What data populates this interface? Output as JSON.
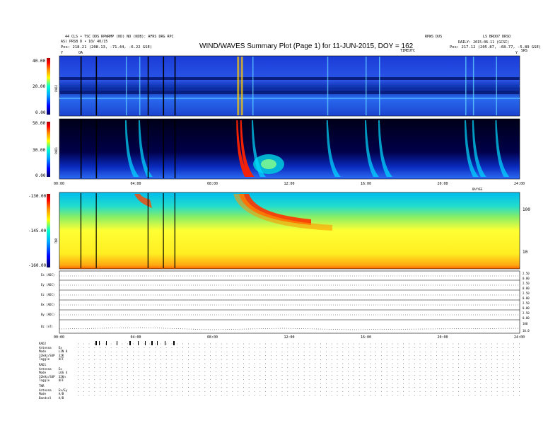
{
  "header": {
    "left_line1": "44 CLS • TSC DDS RPWRMP (KD) NO (KDB): AFRS DRG RPC",
    "left_line2": "AS) PRSB D • 10/ 40/15",
    "left_pos": "Pos: 218.21 (208.13, -71.44, -6.22 GSE)",
    "right_top_a": "RPWS DUS",
    "right_top_b": "LS BROO7 DRSO",
    "right_line2": "DAILY: 2015-06-11 (GCSI)",
    "right_pos": "Pos: 217.12 (205.87, -68.77, -5.89 GSE)",
    "time_label": "TIMEUTC",
    "marker_left_a": "Y",
    "marker_left_b": "OA",
    "marker_right_a": "Y",
    "marker_right_b": "SRS"
  },
  "title": "WIND/WAVES Summary Plot (Page 1) for 11-JUN-2015, DOY = 162",
  "panels": {
    "rad2": {
      "label": "RAD2",
      "ticks": [
        "40.00",
        "20.00",
        "0.00"
      ]
    },
    "rad1": {
      "label": "RAD1",
      "ticks": [
        "50.00",
        "30.00",
        "0.00"
      ]
    },
    "tnr": {
      "label": "TNR",
      "ticks": [
        "-130.00",
        "-145.00",
        "-160.00"
      ],
      "right_ticks": [
        "100",
        "10"
      ],
      "right_caption": "BAYYEE"
    },
    "scalars": [
      {
        "label": "Ex (ADC)",
        "ticks": [
          "2.50",
          "0.00"
        ]
      },
      {
        "label": "Ey (ADC)",
        "ticks": [
          "2.50",
          "0.00"
        ]
      },
      {
        "label": "Ez (ADC)",
        "ticks": [
          "2.50",
          "0.00"
        ]
      },
      {
        "label": "Bx (ADC)",
        "ticks": [
          "2.50",
          "0.00"
        ]
      },
      {
        "label": "By (ADC)",
        "ticks": [
          "2.50",
          "0.00"
        ]
      },
      {
        "label": "Bz (nT)",
        "ticks": [
          "100",
          "10.0"
        ]
      }
    ]
  },
  "time_ticks": [
    "00:00",
    "04:00",
    "08:00",
    "12:00",
    "16:00",
    "20:00",
    "24:00"
  ],
  "housekeeping": {
    "rad2": [
      {
        "name": "RAD2",
        "value": ""
      },
      {
        "name": "Antenna",
        "value": "Ex"
      },
      {
        "name": "Mode",
        "value": "LIN 8"
      },
      {
        "name": "32kHz/SUP",
        "value": "32K"
      },
      {
        "name": "Toggle",
        "value": "OFF"
      }
    ],
    "rad1": [
      {
        "name": "RAD1",
        "value": ""
      },
      {
        "name": "Antenna",
        "value": "Ex"
      },
      {
        "name": "Mode",
        "value": "LOG 4"
      },
      {
        "name": "32kHz/SUP",
        "value": "32Kn"
      },
      {
        "name": "Toggle",
        "value": "OFF"
      }
    ],
    "tnr": [
      {
        "name": "TNR",
        "value": ""
      },
      {
        "name": "Antenna",
        "value": "Ex/Ey"
      },
      {
        "name": "Mode",
        "value": "A/B"
      },
      {
        "name": "Bandsel",
        "value": "A/B"
      }
    ]
  },
  "chart_data": {
    "type": "heatmap",
    "title": "WIND/WAVES Summary Plot (Page 1) for 11-JUN-2015, DOY = 162",
    "xlabel": "",
    "x_range_hours": [
      0,
      24
    ],
    "colormap": [
      "#000066",
      "#0000ff",
      "#00aaff",
      "#00ffcc",
      "#ffff00",
      "#ff8800",
      "#ff0000",
      "#aa0000"
    ],
    "panels": [
      {
        "name": "RAD2",
        "ylim": [
          0,
          40
        ],
        "background": "#1a4ddb"
      },
      {
        "name": "RAD1",
        "ylim": [
          0,
          50
        ],
        "background": "#000040"
      },
      {
        "name": "TNR",
        "ylim": [
          -160,
          -130
        ],
        "background": "#ffff33"
      }
    ],
    "radio_bursts_hours": [
      3.5,
      4.2,
      9.3,
      9.5,
      10.1,
      14.0,
      16.0,
      16.7,
      21.2,
      21.6,
      22.8
    ],
    "data_gaps_hours": [
      1.1,
      1.9,
      4.6,
      5.4,
      6.0
    ]
  }
}
